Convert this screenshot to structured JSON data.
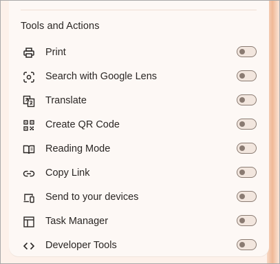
{
  "section": {
    "title": "Tools and Actions"
  },
  "items": [
    {
      "label": "Print",
      "icon": "print-icon",
      "enabled": false
    },
    {
      "label": "Search with Google Lens",
      "icon": "lens-icon",
      "enabled": false
    },
    {
      "label": "Translate",
      "icon": "translate-icon",
      "enabled": false
    },
    {
      "label": "Create QR Code",
      "icon": "qr-code-icon",
      "enabled": false
    },
    {
      "label": "Reading Mode",
      "icon": "book-icon",
      "enabled": false
    },
    {
      "label": "Copy Link",
      "icon": "link-icon",
      "enabled": false
    },
    {
      "label": "Send to your devices",
      "icon": "devices-icon",
      "enabled": false
    },
    {
      "label": "Task Manager",
      "icon": "task-manager-icon",
      "enabled": false
    },
    {
      "label": "Developer Tools",
      "icon": "code-icon",
      "enabled": false
    }
  ],
  "colors": {
    "background": "#fdf1ea",
    "panel": "#fdf8f5",
    "accent": "#f0b896",
    "toggle_off": "#8a7b72"
  }
}
